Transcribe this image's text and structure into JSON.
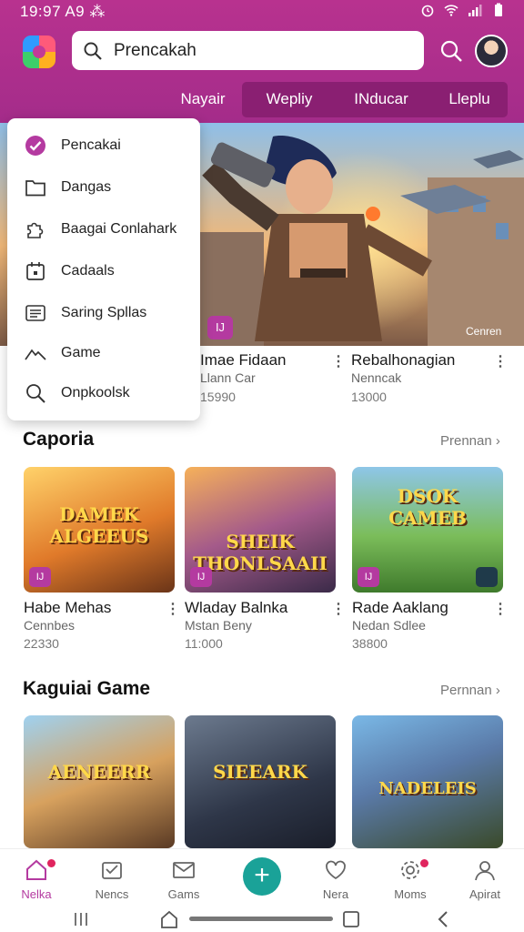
{
  "status": {
    "time": "19:97 A9 ⁂"
  },
  "header": {
    "search_value": "Prencakah",
    "tabs": [
      {
        "label": "Nayair"
      },
      {
        "label": "Wepliy"
      },
      {
        "label": "INducar"
      },
      {
        "label": "Lleplu"
      }
    ]
  },
  "hero": {
    "badge": "IJ",
    "corner_label": "Cenren"
  },
  "menu": {
    "items": [
      {
        "label": "Pencakai",
        "icon": "check-circle-icon"
      },
      {
        "label": "Dangas",
        "icon": "folder-icon"
      },
      {
        "label": "Baagai Conlahark",
        "icon": "puzzle-icon"
      },
      {
        "label": "Cadaals",
        "icon": "calendar-icon"
      },
      {
        "label": "Saring Spllas",
        "icon": "list-icon"
      },
      {
        "label": "Game",
        "icon": "mountain-icon"
      },
      {
        "label": "Onpkoolsk",
        "icon": "search-icon"
      }
    ]
  },
  "row1": [
    {
      "title": "Imae Fidaan",
      "sub": "Llann Car",
      "num": "15990"
    },
    {
      "title": "Rebalhonagian",
      "sub": "Nenncak",
      "num": "13000"
    }
  ],
  "section1": {
    "title": "Caporia",
    "more": "Prennan",
    "cards": [
      {
        "caption": "DAMEK ALGEEUS",
        "title": "Habe Mehas",
        "sub": "Cennbes",
        "num": "22330",
        "badge": "IJ"
      },
      {
        "caption": "SHEIK THONLSAAII",
        "title": "Wladay Balnka",
        "sub": "Mstan Beny",
        "num": "11:000",
        "badge": "IJ"
      },
      {
        "caption": "DSOK CAMEB",
        "title": "Rade Aaklang",
        "sub": "Nedan Sdlee",
        "num": "38800",
        "badge": "IJ"
      }
    ]
  },
  "section2": {
    "title": "Kaguiai Game",
    "more": "Pernnan",
    "cards": [
      {
        "caption": "AENEERR"
      },
      {
        "caption": "SIEEARK"
      },
      {
        "caption": "NADELEIS"
      }
    ]
  },
  "bottom_nav": [
    {
      "label": "Nelka",
      "icon": "home-icon"
    },
    {
      "label": "Nencs",
      "icon": "inbox-icon"
    },
    {
      "label": "Gams",
      "icon": "mail-icon"
    },
    {
      "label": "Nera",
      "icon": "heart-icon"
    },
    {
      "label": "Moms",
      "icon": "gear-icon"
    },
    {
      "label": "Apirat",
      "icon": "person-icon"
    }
  ],
  "colors": {
    "accent": "#b43aa0",
    "header": "#a42c8a",
    "fab": "#1aa298"
  }
}
